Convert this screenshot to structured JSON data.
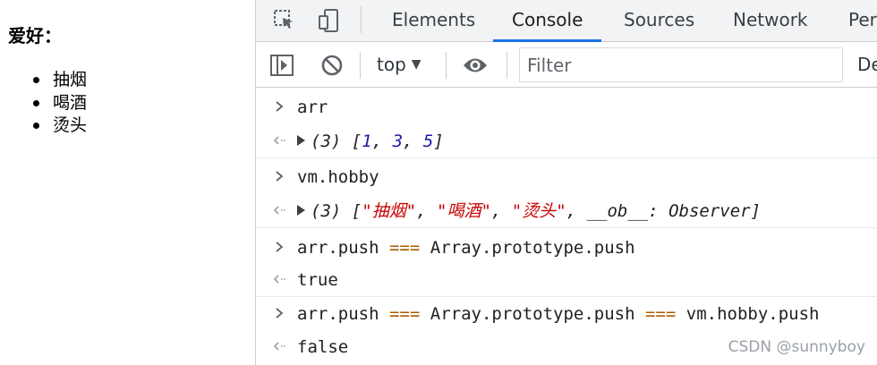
{
  "page": {
    "heading": "爱好：",
    "hobbies": [
      "抽烟",
      "喝酒",
      "烫头"
    ]
  },
  "devtools": {
    "tabs": [
      "Elements",
      "Console",
      "Sources",
      "Network",
      "Per"
    ],
    "active_tab": "Console",
    "toolbar": {
      "context": "top",
      "filter_placeholder": "Filter",
      "levels_label": "De"
    }
  },
  "console": {
    "inputs": [
      "arr",
      "vm.hobby",
      "arr.push === Array.prototype.push",
      "arr.push === Array.prototype.push === vm.hobby.push"
    ],
    "outputs": {
      "arr_count": "(3)",
      "arr_values": [
        "1",
        "3",
        "5"
      ],
      "hobby_count": "(3)",
      "hobby_values": [
        "\"抽烟\"",
        "\"喝酒\"",
        "\"烫头\""
      ],
      "hobby_extra_key": "__ob__",
      "hobby_extra_value": "Observer",
      "result_1": "true",
      "result_2": "false"
    },
    "parts": {
      "push_left": "arr.push",
      "op": "===",
      "push_right": "Array.prototype.push",
      "push_vm": "vm.hobby.push"
    }
  },
  "watermark": "CSDN @sunnyboy",
  "colors": {
    "accent": "#1a73e8",
    "number": "#1a1aa6",
    "string": "#c80000",
    "operator": "#a85d00"
  },
  "icons": [
    "inspect-icon",
    "device-toolbar-icon",
    "sidebar-icon",
    "clear-console-icon",
    "eye-icon",
    "prompt-chevron-icon",
    "result-arrow-icon",
    "expand-triangle-icon"
  ]
}
